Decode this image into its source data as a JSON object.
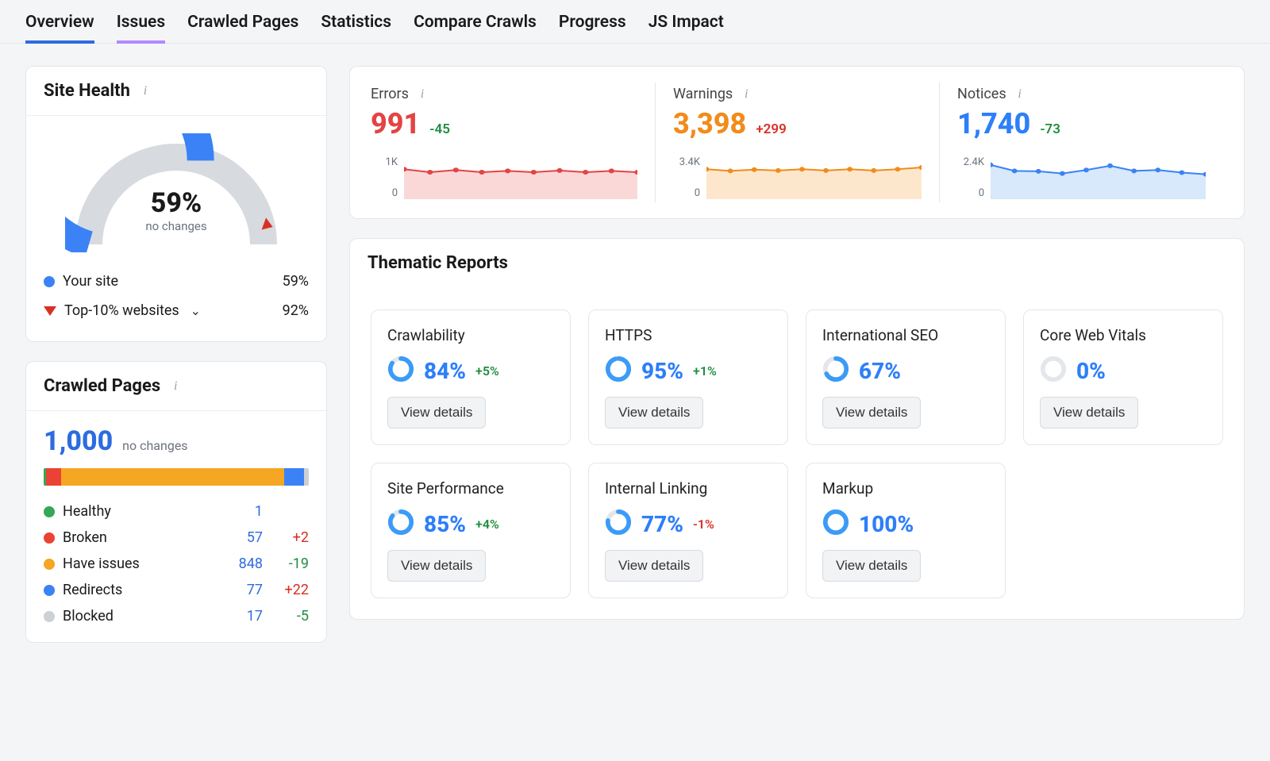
{
  "tabs": [
    "Overview",
    "Issues",
    "Crawled Pages",
    "Statistics",
    "Compare Crawls",
    "Progress",
    "JS Impact"
  ],
  "site_health": {
    "title": "Site Health",
    "pct": "59%",
    "sub": "no changes",
    "gauge_value": 59,
    "legend": {
      "your_site_label": "Your site",
      "your_site_val": "59%",
      "top10_label": "Top-10% websites",
      "top10_val": "92%"
    }
  },
  "crawled_pages": {
    "title": "Crawled Pages",
    "total": "1,000",
    "sub": "no changes",
    "segments": [
      {
        "key": "healthy",
        "w": 1,
        "cls": "seg-green"
      },
      {
        "key": "broken",
        "w": 5.7,
        "cls": "seg-red"
      },
      {
        "key": "have_issues",
        "w": 84.8,
        "cls": "seg-orange"
      },
      {
        "key": "redirects",
        "w": 7.7,
        "cls": "seg-blue"
      },
      {
        "key": "blocked",
        "w": 1.7,
        "cls": "seg-gray"
      }
    ],
    "rows": [
      {
        "dot": "sdot-green",
        "label": "Healthy",
        "count": "1",
        "delta": "",
        "deltaCls": ""
      },
      {
        "dot": "sdot-red",
        "label": "Broken",
        "count": "57",
        "delta": "+2",
        "deltaCls": "delta-neg"
      },
      {
        "dot": "sdot-orange",
        "label": "Have issues",
        "count": "848",
        "delta": "-19",
        "deltaCls": "delta-pos"
      },
      {
        "dot": "sdot-blue",
        "label": "Redirects",
        "count": "77",
        "delta": "+22",
        "deltaCls": "delta-neg"
      },
      {
        "dot": "sdot-gray",
        "label": "Blocked",
        "count": "17",
        "delta": "-5",
        "deltaCls": "delta-pos"
      }
    ]
  },
  "metrics": [
    {
      "title": "Errors",
      "value": "991",
      "delta": "-45",
      "deltaCls": "delta-pos",
      "valCls": "val-red",
      "sparkFill": "#fbd8d8",
      "sparkStroke": "#e24444",
      "yhi": "1K",
      "ylo": "0",
      "points": [
        0.7,
        0.63,
        0.68,
        0.63,
        0.66,
        0.63,
        0.67,
        0.63,
        0.66,
        0.63
      ]
    },
    {
      "title": "Warnings",
      "value": "3,398",
      "delta": "+299",
      "deltaCls": "delta-neg",
      "valCls": "val-orange",
      "sparkFill": "#fde7cc",
      "sparkStroke": "#f08c1a",
      "yhi": "3.4K",
      "ylo": "0",
      "points": [
        0.7,
        0.66,
        0.69,
        0.67,
        0.7,
        0.67,
        0.7,
        0.67,
        0.7,
        0.74
      ]
    },
    {
      "title": "Notices",
      "value": "1,740",
      "delta": "-73",
      "deltaCls": "delta-pos",
      "valCls": "val-blue",
      "sparkFill": "#d7e9fb",
      "sparkStroke": "#3b82f6",
      "yhi": "2.4K",
      "ylo": "0",
      "points": [
        0.8,
        0.66,
        0.65,
        0.6,
        0.68,
        0.78,
        0.66,
        0.68,
        0.62,
        0.58
      ]
    }
  ],
  "thematic": {
    "title": "Thematic Reports",
    "button_label": "View details",
    "cards": [
      {
        "title": "Crawlability",
        "pct": "84%",
        "pctNum": 84,
        "delta": "+5%",
        "deltaCls": "delta-pos"
      },
      {
        "title": "HTTPS",
        "pct": "95%",
        "pctNum": 95,
        "delta": "+1%",
        "deltaCls": "delta-pos"
      },
      {
        "title": "International SEO",
        "pct": "67%",
        "pctNum": 67,
        "delta": "",
        "deltaCls": ""
      },
      {
        "title": "Core Web Vitals",
        "pct": "0%",
        "pctNum": 0,
        "delta": "",
        "deltaCls": ""
      },
      {
        "title": "Site Performance",
        "pct": "85%",
        "pctNum": 85,
        "delta": "+4%",
        "deltaCls": "delta-pos"
      },
      {
        "title": "Internal Linking",
        "pct": "77%",
        "pctNum": 77,
        "delta": "-1%",
        "deltaCls": "delta-neg"
      },
      {
        "title": "Markup",
        "pct": "100%",
        "pctNum": 100,
        "delta": "",
        "deltaCls": ""
      }
    ]
  },
  "chart_data": {
    "site_health_gauge": {
      "type": "gauge",
      "value": 59,
      "range": [
        0,
        100
      ],
      "benchmarks": {
        "top10": 92
      }
    },
    "crawled_pages_breakdown": {
      "type": "bar",
      "categories": [
        "Healthy",
        "Broken",
        "Have issues",
        "Redirects",
        "Blocked"
      ],
      "values": [
        1,
        57,
        848,
        77,
        17
      ],
      "deltas": [
        null,
        2,
        -19,
        22,
        -5
      ],
      "total": 1000
    },
    "errors_spark": {
      "type": "line",
      "yhi": 1000,
      "ylo": 0,
      "values": [
        700,
        630,
        680,
        630,
        660,
        630,
        670,
        630,
        660,
        630
      ],
      "current": 991,
      "delta": -45
    },
    "warnings_spark": {
      "type": "line",
      "yhi": 3400,
      "ylo": 0,
      "values": [
        2380,
        2244,
        2346,
        2278,
        2380,
        2278,
        2380,
        2278,
        2380,
        2516
      ],
      "current": 3398,
      "delta": 299
    },
    "notices_spark": {
      "type": "line",
      "yhi": 2400,
      "ylo": 0,
      "values": [
        1920,
        1584,
        1560,
        1440,
        1632,
        1872,
        1584,
        1632,
        1488,
        1392
      ],
      "current": 1740,
      "delta": -73
    },
    "thematic_scores": {
      "type": "table",
      "rows": [
        [
          "Crawlability",
          84,
          5
        ],
        [
          "HTTPS",
          95,
          1
        ],
        [
          "International SEO",
          67,
          null
        ],
        [
          "Core Web Vitals",
          0,
          null
        ],
        [
          "Site Performance",
          85,
          4
        ],
        [
          "Internal Linking",
          77,
          -1
        ],
        [
          "Markup",
          100,
          null
        ]
      ]
    }
  }
}
